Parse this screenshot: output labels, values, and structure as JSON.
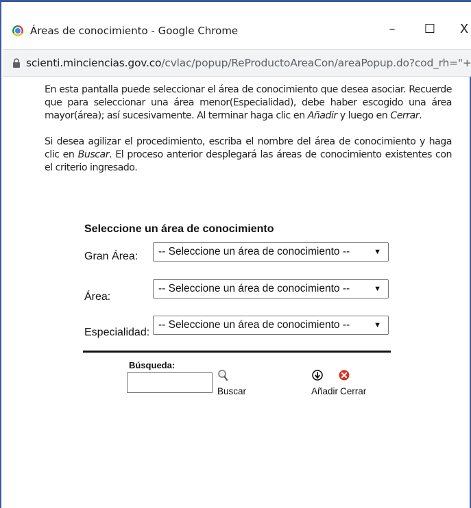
{
  "window": {
    "title": "Áreas de conocimiento - Google Chrome",
    "minimize": "–",
    "maximize": "☐",
    "close": "X"
  },
  "address": {
    "domain": "scienti.minciencias.gov.co",
    "path": "/cvlac/popup/ReProductoAreaCon/areaPopup.do?cod_rh=\"+..."
  },
  "instructions": {
    "p1_a": "En esta pantalla puede seleccionar el área de conocimiento que desea asociar. Recuerde que para seleccionar una área menor(Especialidad), debe haber escogido una área mayor(área); así sucesivamente. Al terminar haga clic en ",
    "p1_em1": "Añadir",
    "p1_b": " y luego en ",
    "p1_em2": "Cerrar",
    "p1_c": ".",
    "p2_a": "Si desea agilizar el procedimiento, escriba el nombre del área de conocimiento y haga clic en ",
    "p2_em": "Buscar",
    "p2_b": ". El proceso anterior desplegará las áreas de conocimiento existentes con el criterio ingresado."
  },
  "form": {
    "heading": "Seleccione un área de conocimiento",
    "fields": [
      {
        "label": "Gran Área:",
        "selected": "-- Seleccione un área de conocimiento --"
      },
      {
        "label": "Área:",
        "selected": "-- Seleccione un área de conocimiento --"
      },
      {
        "label": "Especialidad:",
        "selected": "-- Seleccione un área de conocimiento --"
      }
    ],
    "dropdown_arrow": "▼"
  },
  "search": {
    "label": "Búsqueda:",
    "value": "",
    "button_label": "Buscar"
  },
  "actions": {
    "add_label": "Añadir",
    "close_label": "Cerrar"
  },
  "colors": {
    "window_border": "#3a5aa0",
    "close_icon": "#d93025"
  }
}
